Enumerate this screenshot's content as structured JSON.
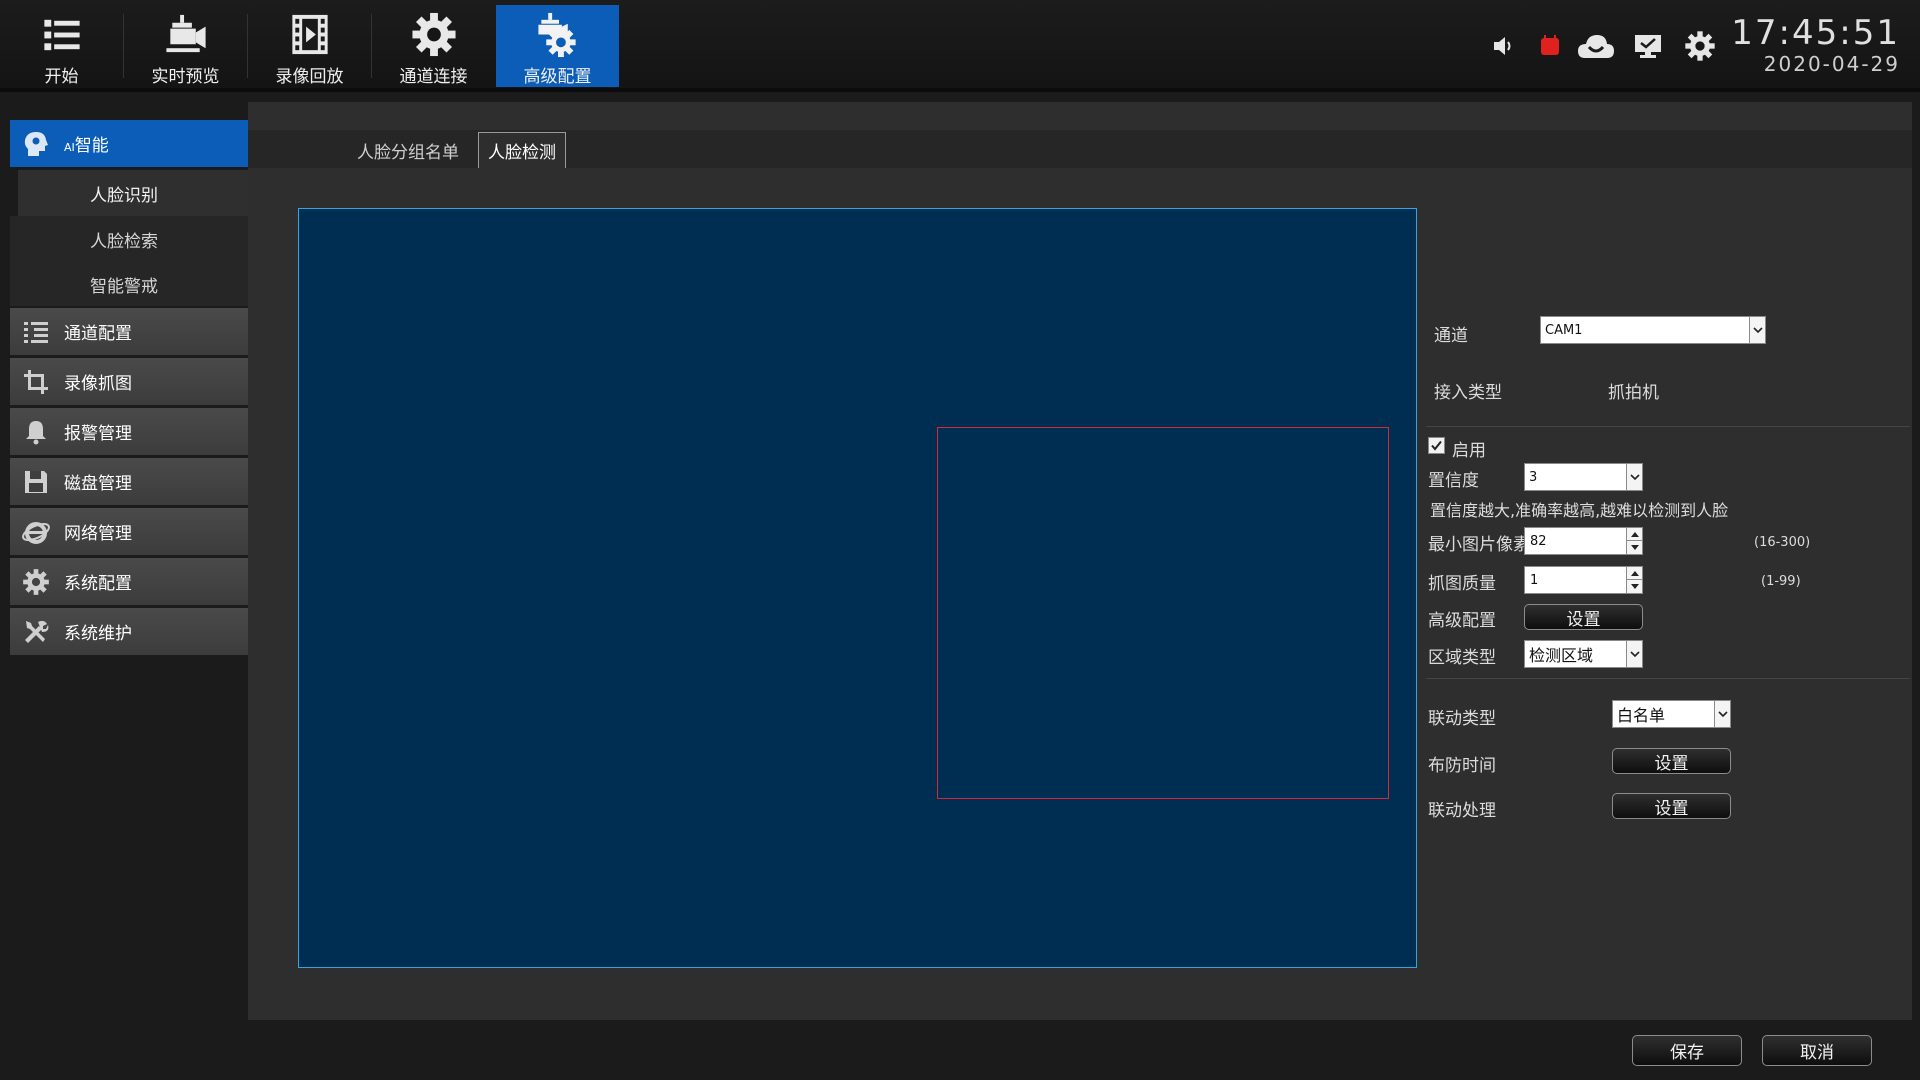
{
  "nav": {
    "items": [
      {
        "label": "开始",
        "icon": "list-icon"
      },
      {
        "label": "实时预览",
        "icon": "camera-icon"
      },
      {
        "label": "录像回放",
        "icon": "film-icon"
      },
      {
        "label": "通道连接",
        "icon": "gear-icon"
      },
      {
        "label": "高级配置",
        "icon": "advanced-settings-icon"
      }
    ],
    "active_index": 4
  },
  "tray": {
    "icons": [
      "volume-icon",
      "record-status-icon",
      "cloud-icon",
      "monitor-icon",
      "settings-icon"
    ],
    "record_color": "#e0221f"
  },
  "clock": {
    "time": "17:45:51",
    "date": "2020-04-29"
  },
  "sidebar": {
    "ai": {
      "label": "AI智能",
      "badge": "AI",
      "text": "智能"
    },
    "sub": [
      "人脸识别",
      "人脸检索",
      "智能警戒"
    ],
    "items": [
      {
        "label": "通道配置",
        "icon": "channel-config-icon"
      },
      {
        "label": "录像抓图",
        "icon": "crop-icon"
      },
      {
        "label": "报警管理",
        "icon": "bell-icon"
      },
      {
        "label": "磁盘管理",
        "icon": "disk-icon"
      },
      {
        "label": "网络管理",
        "icon": "network-icon"
      },
      {
        "label": "系统配置",
        "icon": "system-gear-icon"
      },
      {
        "label": "系统维护",
        "icon": "tools-icon"
      }
    ]
  },
  "tabs": [
    "人脸分组名单",
    "人脸检测"
  ],
  "form": {
    "channel": {
      "label": "通道",
      "value": "CAM1"
    },
    "access_type": {
      "label": "接入类型",
      "value": "抓拍机"
    },
    "enable": {
      "label": "启用",
      "checked": true
    },
    "confidence": {
      "label": "置信度",
      "value": "3",
      "note": "置信度越大,准确率越高,越难以检测到人脸"
    },
    "min_pixel": {
      "label": "最小图片像素",
      "value": "82",
      "range": "(16-300)"
    },
    "quality": {
      "label": "抓图质量",
      "value": "1",
      "range": "(1-99)"
    },
    "advanced": {
      "label": "高级配置",
      "button": "设置"
    },
    "region_type": {
      "label": "区域类型",
      "value": "检测区域"
    },
    "linkage_type": {
      "label": "联动类型",
      "value": "白名单"
    },
    "schedule": {
      "label": "布防时间",
      "button": "设置"
    },
    "linkage_action": {
      "label": "联动处理",
      "button": "设置"
    }
  },
  "footer": {
    "save": "保存",
    "cancel": "取消"
  },
  "colors": {
    "accent": "#0b5db8",
    "preview_bg": "#002d52",
    "roi_border": "#d42b3a"
  }
}
